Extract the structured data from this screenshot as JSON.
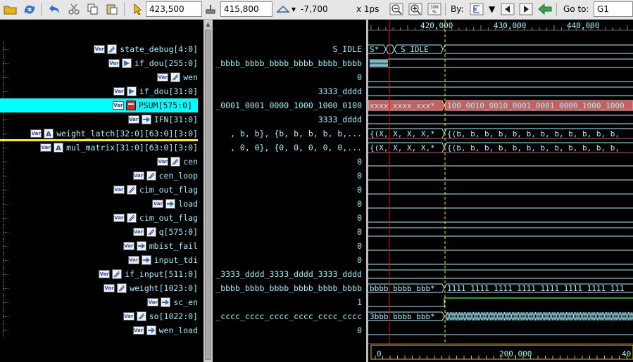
{
  "toolbar": {
    "icons": [
      "open-folder-icon",
      "reload-icon",
      "undo-icon",
      "cut-icon",
      "copy-icon",
      "paste-icon",
      "cursor-icon",
      "marker-icon",
      "delta-icon",
      "zoom-out-icon",
      "zoom-in-icon",
      "zoom-100-icon",
      "search-by-icon",
      "dropdown-icon",
      "prev-icon",
      "next-icon",
      "back-icon"
    ],
    "cursor_time": "423,500",
    "marker_time": "415,800",
    "delta_value": "-7,700",
    "time_unit": "x 1ps",
    "zoom_100_label": "100\n%",
    "by_label": "By:",
    "goto_label": "Go to:",
    "goto_value": "G1"
  },
  "signals": [
    {
      "name": "state_debug[4:0]",
      "icon": "analog-icon",
      "value": "S_IDLE"
    },
    {
      "name": "if_dou[255:0]",
      "icon": "output-port-icon",
      "value": "_bbbb_bbbb_bbbb_bbbb_bbbb_bbbb"
    },
    {
      "name": "wen",
      "icon": "analog-icon",
      "value": "0"
    },
    {
      "name": "if_dou[31:0]",
      "icon": "output-port-icon",
      "value": "3333_dddd"
    },
    {
      "name": "PSUM[575:0]",
      "icon": "red-port-icon",
      "value": "_0001_0001_0000_1000_1000_0100"
    },
    {
      "name": "IFN[31:0]",
      "icon": "input-port-icon",
      "value": "3333_dddd"
    },
    {
      "name": "weight_latch[32:0][63:0][3:0]",
      "icon": "array-icon",
      "value": ", b, b}, {b, b, b, b, b,..."
    },
    {
      "name": "mul_matrix[31:0][63:0][3:0]",
      "icon": "array-icon",
      "value": ", 0, 0}, {0, 0, 0, 0, 0,..."
    },
    {
      "name": "cen",
      "icon": "analog-icon",
      "value": "0"
    },
    {
      "name": "cen_loop",
      "icon": "analog-icon",
      "value": "0"
    },
    {
      "name": "cim_out_flag",
      "icon": "analog-icon",
      "value": "0"
    },
    {
      "name": "load",
      "icon": "input-port-icon",
      "value": "0"
    },
    {
      "name": "cim_out_flag",
      "icon": "analog-icon",
      "value": "0"
    },
    {
      "name": "q[575:0]",
      "icon": "analog-icon",
      "value": "0"
    },
    {
      "name": "mbist_fail",
      "icon": "input-port-icon",
      "value": "0"
    },
    {
      "name": "input_tdi",
      "icon": "input-port-icon",
      "value": "0"
    },
    {
      "name": "if_input[511:0]",
      "icon": "analog-icon",
      "value": "_3333_dddd_3333_dddd_3333_dddd"
    },
    {
      "name": "weight[1023:0]",
      "icon": "analog-icon",
      "value": "_bbbb_bbbb_bbbb_bbbb_bbbb_bbbb"
    },
    {
      "name": "sc_en",
      "icon": "input-port-icon",
      "value": "1"
    },
    {
      "name": "so[1022:0]",
      "icon": "analog-icon",
      "value": "_cccc_cccc_cccc_cccc_cccc_cccc"
    },
    {
      "name": "wen_load",
      "icon": "input-port-icon",
      "value": "0"
    }
  ],
  "var_badge": "Var",
  "timeline": {
    "top_ticks": [
      "420,000",
      "430,000",
      "440,000"
    ],
    "bottom_ticks": [
      "0",
      "200,000",
      "40"
    ]
  },
  "wave_labels": {
    "state_s": "S*",
    "state_idle": "S_IDLE",
    "psum_before": "xxxx_xxxx_xxx*",
    "psum_after": "100_0010_0010_0001_0001_0000_1000_1000",
    "wl_before": "{(X, X, X, X,*",
    "wl_after": "{(b, b, b, b, b, b, b, b, b, b, b, b,",
    "mm_before": "{(X, X, X, X,*",
    "mm_after": "{(b, b, b, b, b, b, b, b, b, b, b, b,",
    "weight_before": "bbbb_bbbb_bbb*",
    "weight_after": "1111_1111_1111_1111_1111_1111_1111_111",
    "so_before": "3bbb_bbbb_bbb*"
  },
  "colors": {
    "selection": "#00ffff",
    "marker_line": "#ffee00",
    "cursor_line": "#ff0000",
    "wave": "#9ef0ff",
    "psum_bus": "#c46060",
    "sc_en_high": "#22dd22"
  }
}
